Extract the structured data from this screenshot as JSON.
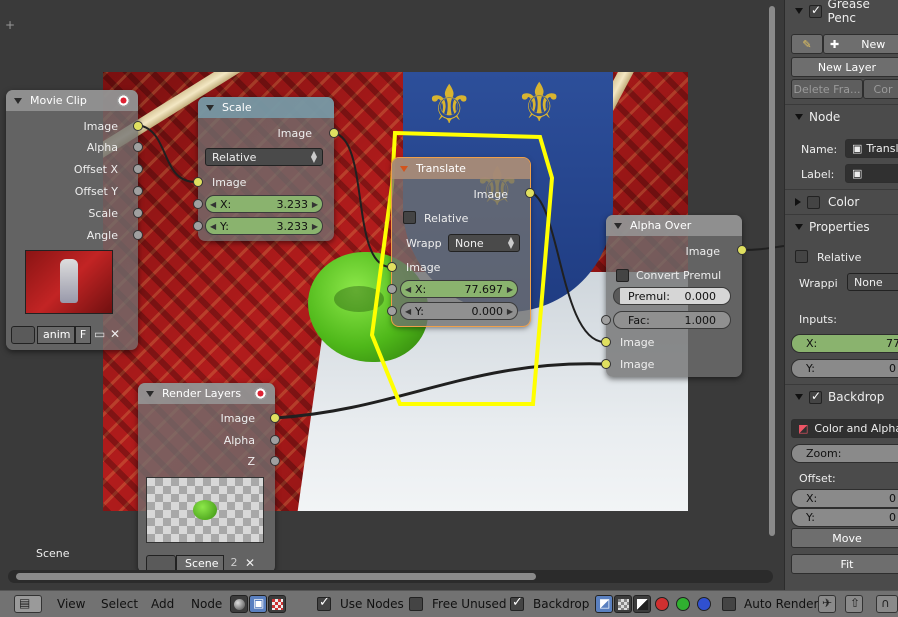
{
  "nodes": {
    "movie_clip": {
      "title": "Movie Clip",
      "outputs": [
        "Image",
        "Alpha",
        "Offset X",
        "Offset Y",
        "Scale",
        "Angle"
      ],
      "clip_name": "anim",
      "f_label": "F"
    },
    "scale": {
      "title": "Scale",
      "output": "Image",
      "mode": "Relative",
      "input": "Image",
      "x_label": "X:",
      "x_value": "3.233",
      "y_label": "Y:",
      "y_value": "3.233"
    },
    "translate": {
      "title": "Translate",
      "output": "Image",
      "relative_label": "Relative",
      "wrap_label": "Wrapp",
      "wrap_value": "None",
      "input": "Image",
      "x_label": "X:",
      "x_value": "77.697",
      "y_label": "Y:",
      "y_value": "0.000"
    },
    "alpha_over": {
      "title": "Alpha Over",
      "output": "Image",
      "convert_label": "Convert Premul",
      "premul_label": "Premul:",
      "premul_value": "0.000",
      "fac_label": "Fac:",
      "fac_value": "1.000",
      "input1": "Image",
      "input2": "Image"
    },
    "render_layers": {
      "title": "Render Layers",
      "outputs": [
        "Image",
        "Alpha",
        "Z"
      ],
      "scene_name": "Scene",
      "scene_users": "2"
    }
  },
  "editor": {
    "scene_label": "Scene"
  },
  "panel": {
    "grease_pencil": "Grease Penc",
    "new_label": "New",
    "new_layer": "New Layer",
    "delete_frame": "Delete Fra...",
    "convert": "Cor",
    "node_section": "Node",
    "name_label": "Name:",
    "name_value": "Transl",
    "label_label": "Label:",
    "color_section": "Color",
    "properties_section": "Properties",
    "relative_label": "Relative",
    "wrap_label": "Wrappi",
    "wrap_value": "None",
    "inputs_label": "Inputs:",
    "input_x_label": "X:",
    "input_x_value": "77",
    "input_y_label": "Y:",
    "input_y_value": "0",
    "backdrop_section": "Backdrop",
    "color_mode": "Color and Alpha",
    "zoom_label": "Zoom:",
    "offset_label": "Offset:",
    "offset_x_label": "X:",
    "offset_x_value": "0",
    "offset_y_label": "Y:",
    "offset_y_value": "0",
    "move_button": "Move",
    "fit_button": "Fit"
  },
  "bottom_bar": {
    "view": "View",
    "select": "Select",
    "add": "Add",
    "node": "Node",
    "use_nodes": "Use Nodes",
    "free_unused": "Free Unused",
    "backdrop": "Backdrop",
    "auto_render": "Auto Render"
  },
  "colors": {
    "socket_image": "#e0e060",
    "socket_value": "#a0a0a0",
    "field_green": "#8ab36e",
    "header_blue": "#789caa",
    "selection_yellow": "#ffff00"
  }
}
